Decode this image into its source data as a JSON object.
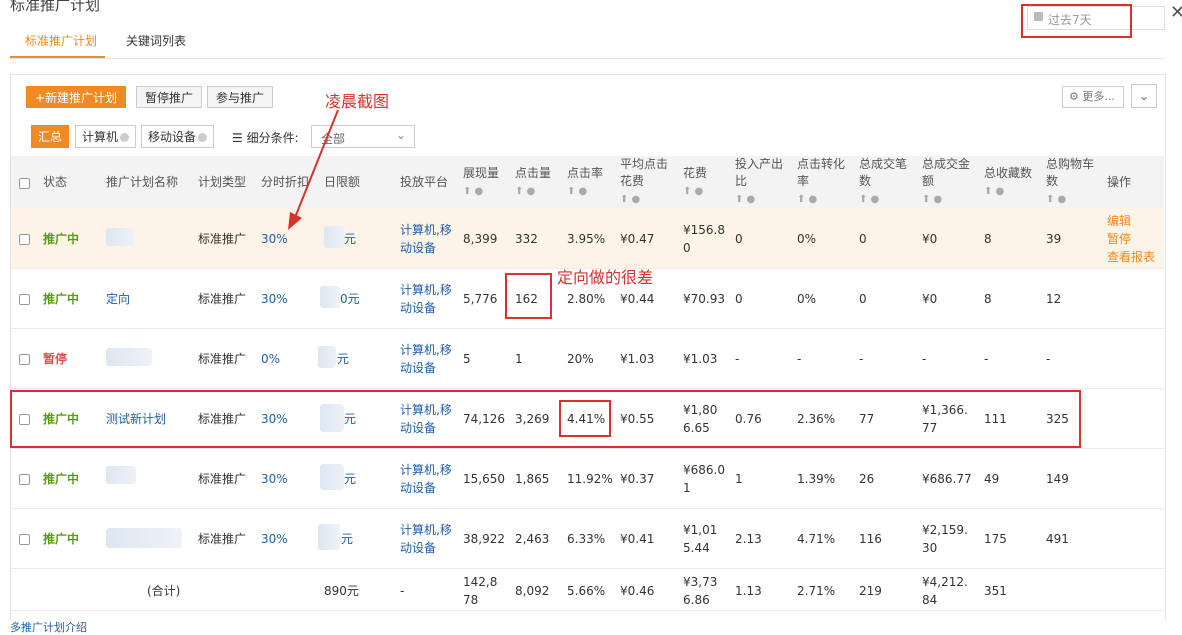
{
  "page": {
    "title": "标准推广计划"
  },
  "tabs": [
    {
      "label": "标准推广计划"
    },
    {
      "label": "关键词列表"
    }
  ],
  "date_range": {
    "label": "过去7天"
  },
  "toolbar": {
    "new_plan": "+新建推广计划",
    "pause": "暂停推广",
    "join": "参与推广",
    "more": "更多...",
    "chevron": "⌄"
  },
  "segments": [
    {
      "label": "汇总"
    },
    {
      "label": "计算机"
    },
    {
      "label": "移动设备"
    }
  ],
  "filter": {
    "label": "细分条件:",
    "value": "全部"
  },
  "headers": [
    "状态",
    "推广计划名称",
    "计划类型",
    "分时折扣",
    "日限额",
    "投放平台",
    "展现量",
    "点击量",
    "点击率",
    "平均点击花费",
    "花费",
    "投入产出比",
    "点击转化率",
    "总成交笔数",
    "总成交金额",
    "总收藏数",
    "总购物车数",
    "操作"
  ],
  "rows": [
    {
      "status": "推广中",
      "name": "",
      "type": "标准推广",
      "discount": "30%",
      "budget": "元",
      "platform": "计算机,移动设备",
      "impr": "8,399",
      "clicks": "332",
      "ctr": "3.95%",
      "cpc": "¥0.47",
      "cost": "¥156.80",
      "roi": "0",
      "cvr": "0%",
      "orders": "0",
      "gmv": "¥0",
      "fav": "8",
      "cart": "39",
      "ops": [
        "编辑",
        "暂停",
        "查看报表"
      ]
    },
    {
      "status": "推广中",
      "name": "定向",
      "type": "标准推广",
      "discount": "30%",
      "budget": "0元",
      "platform": "计算机,移动设备",
      "impr": "5,776",
      "clicks": "162",
      "ctr": "2.80%",
      "cpc": "¥0.44",
      "cost": "¥70.93",
      "roi": "0",
      "cvr": "0%",
      "orders": "0",
      "gmv": "¥0",
      "fav": "8",
      "cart": "12"
    },
    {
      "status": "暂停",
      "name": "",
      "type": "标准推广",
      "discount": "0%",
      "budget": "元",
      "platform": "计算机,移动设备",
      "impr": "5",
      "clicks": "1",
      "ctr": "20%",
      "cpc": "¥1.03",
      "cost": "¥1.03",
      "roi": "-",
      "cvr": "-",
      "orders": "-",
      "gmv": "-",
      "fav": "-",
      "cart": "-"
    },
    {
      "status": "推广中",
      "name": "测试新计划",
      "type": "标准推广",
      "discount": "30%",
      "budget": "元",
      "platform": "计算机,移动设备",
      "impr": "74,126",
      "clicks": "3,269",
      "ctr": "4.41%",
      "cpc": "¥0.55",
      "cost": "¥1,806.65",
      "roi": "0.76",
      "cvr": "2.36%",
      "orders": "77",
      "gmv": "¥1,366.77",
      "fav": "111",
      "cart": "325"
    },
    {
      "status": "推广中",
      "name": "",
      "type": "标准推广",
      "discount": "30%",
      "budget": "元",
      "platform": "计算机,移动设备",
      "impr": "15,650",
      "clicks": "1,865",
      "ctr": "11.92%",
      "cpc": "¥0.37",
      "cost": "¥686.01",
      "roi": "1",
      "cvr": "1.39%",
      "orders": "26",
      "gmv": "¥686.77",
      "fav": "49",
      "cart": "149"
    },
    {
      "status": "推广中",
      "name": "",
      "type": "标准推广",
      "discount": "30%",
      "budget": "元",
      "platform": "计算机,移动设备",
      "impr": "38,922",
      "clicks": "2,463",
      "ctr": "6.33%",
      "cpc": "¥0.41",
      "cost": "¥1,015.44",
      "roi": "2.13",
      "cvr": "4.71%",
      "orders": "116",
      "gmv": "¥2,159.30",
      "fav": "175",
      "cart": "491"
    }
  ],
  "total": {
    "label": "(合计)",
    "budget": "890元",
    "platform": "-",
    "impr": "142,878",
    "clicks": "8,092",
    "ctr": "5.66%",
    "cpc": "¥0.46",
    "cost": "¥3,736.86",
    "roi": "1.13",
    "cvr": "2.71%",
    "orders": "219",
    "gmv": "¥4,212.84",
    "fav": "351"
  },
  "annotations": {
    "screenshot_credit": "凌晨截图",
    "targeting_note": "定向做的很差"
  },
  "footer": {
    "text": "多推广计划介绍"
  },
  "colors": {
    "accent": "#f08a24",
    "status_on": "#5c9a1a",
    "status_off": "#d9534f",
    "link": "#1f5fa8",
    "annotation": "#d8322b"
  }
}
